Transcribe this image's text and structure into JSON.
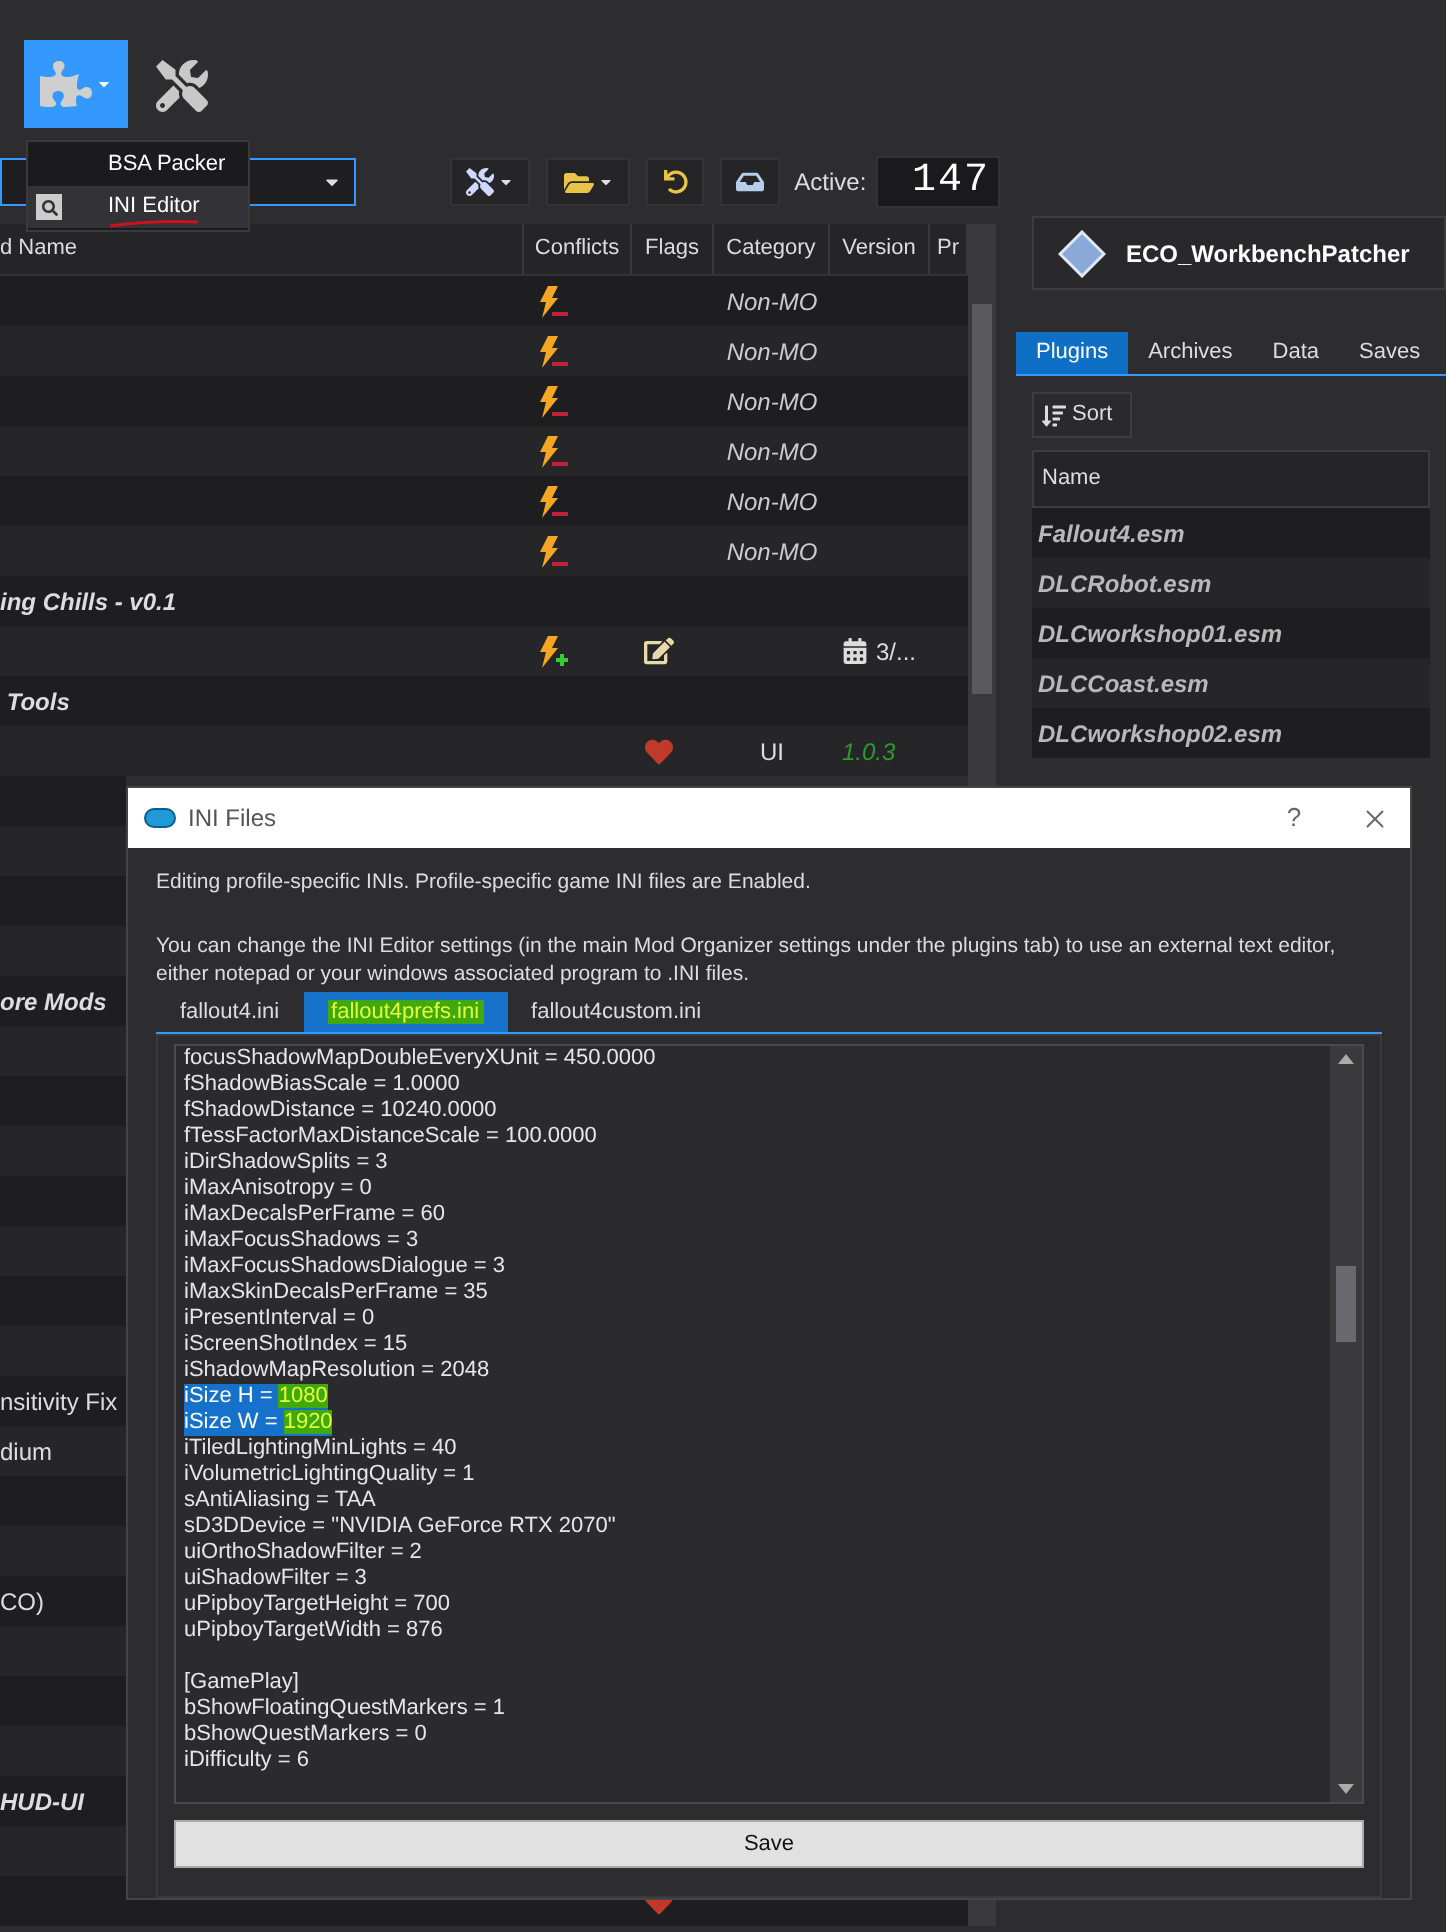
{
  "tools_menu": {
    "items": [
      {
        "label": "BSA Packer",
        "selected": false,
        "underlined": false
      },
      {
        "label": "INI Editor",
        "selected": true,
        "underlined": true
      }
    ]
  },
  "toolbar": {
    "active_label": "Active:",
    "active_count": "147"
  },
  "mod_list": {
    "columns": [
      "d Name",
      "Conflicts",
      "Flags",
      "Category",
      "Version",
      "Pr"
    ],
    "rows": [
      {
        "kind": "mod",
        "conflict_loses": true,
        "category": "Non-MO"
      },
      {
        "kind": "mod",
        "conflict_loses": true,
        "category": "Non-MO"
      },
      {
        "kind": "mod",
        "conflict_loses": true,
        "category": "Non-MO"
      },
      {
        "kind": "mod",
        "conflict_loses": true,
        "category": "Non-MO"
      },
      {
        "kind": "mod",
        "conflict_loses": true,
        "category": "Non-MO"
      },
      {
        "kind": "mod",
        "conflict_loses": true,
        "category": "Non-MO"
      },
      {
        "kind": "separator",
        "name": "ing Chills - v0.1"
      },
      {
        "kind": "mod",
        "conflict_wins": true,
        "has_notes": true,
        "has_date": true,
        "version": "3/..."
      },
      {
        "kind": "separator",
        "name": " Tools"
      },
      {
        "kind": "mod",
        "flag_warning": true,
        "category": "UI",
        "version": "1.0.3"
      },
      {
        "kind": "mod"
      },
      {
        "kind": "mod"
      },
      {
        "kind": "mod"
      },
      {
        "kind": "mod"
      },
      {
        "kind": "separator",
        "name": "ore Mods"
      },
      {
        "kind": "mod"
      },
      {
        "kind": "mod"
      },
      {
        "kind": "mod"
      },
      {
        "kind": "mod"
      },
      {
        "kind": "mod"
      },
      {
        "kind": "mod"
      },
      {
        "kind": "mod"
      },
      {
        "kind": "mod",
        "name": "nsitivity Fix"
      },
      {
        "kind": "mod",
        "name": "dium"
      },
      {
        "kind": "mod"
      },
      {
        "kind": "mod"
      },
      {
        "kind": "mod",
        "name": "CO)"
      },
      {
        "kind": "mod"
      },
      {
        "kind": "mod"
      },
      {
        "kind": "mod"
      },
      {
        "kind": "separator",
        "name": "HUD-UI"
      },
      {
        "kind": "mod"
      },
      {
        "kind": "mod",
        "flag_warning": true
      }
    ]
  },
  "right_panel": {
    "executable": "ECO_WorkbenchPatcher",
    "tabs": [
      {
        "label": "Plugins",
        "selected": true
      },
      {
        "label": "Archives",
        "selected": false
      },
      {
        "label": "Data",
        "selected": false
      },
      {
        "label": "Saves",
        "selected": false
      }
    ],
    "sort_button": "Sort",
    "name_column": "Name",
    "plugins": [
      "Fallout4.esm",
      "DLCRobot.esm",
      "DLCworkshop01.esm",
      "DLCCoast.esm",
      "DLCworkshop02.esm"
    ]
  },
  "dialog": {
    "title": "INI Files",
    "help_glyph": "?",
    "info": "Editing profile-specific INIs. Profile-specific game INI files are Enabled.",
    "hint": "You can change the INI Editor settings (in the main Mod Organizer settings under the plugins tab) to use an external text editor, either notepad or your windows associated program to .INI files.",
    "tabs": [
      {
        "label": "fallout4.ini",
        "selected": false,
        "highlighted": false
      },
      {
        "label": "fallout4prefs.ini",
        "selected": true,
        "highlighted": true
      },
      {
        "label": "fallout4custom.ini",
        "selected": false,
        "highlighted": false
      }
    ],
    "sections": [
      {
        "lines": [
          {
            "text": "focusShadowMapDoubleEveryXUnit = 450.0000",
            "selected": false
          },
          {
            "text": "fShadowBiasScale = 1.0000",
            "selected": false
          },
          {
            "text": "fShadowDistance = 10240.0000",
            "selected": false
          },
          {
            "text": "fTessFactorMaxDistanceScale = 100.0000",
            "selected": false
          },
          {
            "text": "iDirShadowSplits = 3",
            "selected": false
          },
          {
            "text": "iMaxAnisotropy = 0",
            "selected": false
          },
          {
            "text": "iMaxDecalsPerFrame = 60",
            "selected": false
          },
          {
            "text": "iMaxFocusShadows = 3",
            "selected": false
          },
          {
            "text": "iMaxFocusShadowsDialogue = 3",
            "selected": false
          },
          {
            "text": "iMaxSkinDecalsPerFrame = 35",
            "selected": false
          },
          {
            "text": "iPresentInterval = 0",
            "selected": false
          },
          {
            "text": "iScreenShotIndex = 15",
            "selected": false
          },
          {
            "text": "iShadowMapResolution = 2048",
            "selected": false
          },
          {
            "text": "iSize H = ",
            "marked": "1080",
            "selected": true
          },
          {
            "text": "iSize W = ",
            "marked": "1920",
            "selected": true
          },
          {
            "text": "iTiledLightingMinLights = 40",
            "selected": false
          },
          {
            "text": "iVolumetricLightingQuality = 1",
            "selected": false
          },
          {
            "text": "sAntiAliasing = TAA",
            "selected": false
          },
          {
            "text": "sD3DDevice = \"NVIDIA GeForce RTX 2070\"",
            "selected": false
          },
          {
            "text": "uiOrthoShadowFilter = 2",
            "selected": false
          },
          {
            "text": "uiShadowFilter = 3",
            "selected": false
          },
          {
            "text": "uPipboyTargetHeight = 700",
            "selected": false
          },
          {
            "text": "uPipboyTargetWidth = 876",
            "selected": false
          }
        ]
      },
      {
        "lines": [
          {
            "text": "[GamePlay]",
            "selected": false
          },
          {
            "text": "bShowFloatingQuestMarkers = 1",
            "selected": false
          },
          {
            "text": "bShowQuestMarkers = 0",
            "selected": false
          },
          {
            "text": "iDifficulty = 6",
            "selected": false
          }
        ]
      }
    ],
    "save_button": "Save"
  }
}
